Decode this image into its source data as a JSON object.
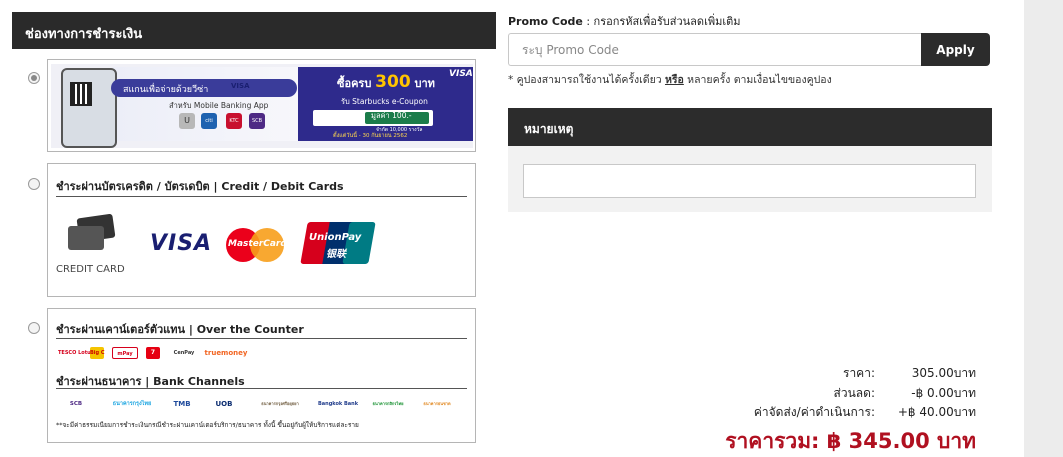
{
  "payment": {
    "header": "ช่องทางการชำระเงิน",
    "qr_banner": {
      "scan_text": "สแกนเพื่อจ่ายด้วยวีซ่า",
      "for_app": "สำหรับ Mobile Banking App",
      "brand": "VISA",
      "promo_head": "ซื้อครบ",
      "promo_amount": "300",
      "promo_unit": "บาท",
      "promo_sub": "รับ Starbucks e-Coupon",
      "coupon_value": "มูลค่า 100.-",
      "coupon_limit": "จำกัด 10,000 รางวัล",
      "period": "ตั้งแต่วันนี้ - 30 กันยายน 2562",
      "bank_logos": [
        "U",
        "citi",
        "KTC",
        "SCB"
      ]
    },
    "card_option": {
      "title": "ชำระผ่านบัตรเครดิต / บัตรเดบิต  |  Credit / Debit Cards",
      "credit_card_label": "CREDIT CARD",
      "visa_label": "VISA",
      "mastercard_label": "MasterCard",
      "unionpay_label": "UnionPay",
      "unionpay_cn": "银联"
    },
    "counter_option": {
      "title": "ชำระผ่านเคาน์เตอร์ตัวแทน  |  Over the Counter",
      "counter_logos": [
        "TESCO Lotus",
        "Big C",
        "mPay",
        "7",
        "CenPay",
        "truemoney"
      ],
      "bank_title": "ชำระผ่านธนาคาร  |  Bank Channels",
      "bank_logos": [
        "SCB",
        "ธนาคารกรุงไทย",
        "TMB",
        "UOB",
        "ธนาคารกรุงศรีอยุธยา",
        "Bangkok Bank",
        "ธนาคารกสิกรไทย",
        "ธนาคารธนชาต"
      ],
      "fee_note": "**จะมีค่าธรรมเนียมการชำระเงินกรณีชำระผ่านเคาน์เตอร์บริการ/ธนาคาร ทั้งนี้ ขึ้นอยู่กับผู้ให้บริการแต่ละราย"
    }
  },
  "promo": {
    "label": "Promo Code",
    "label_hint": " : กรอกรหัสเพื่อรับส่วนลดเพิ่มเติม",
    "placeholder": "ระบุ Promo Code",
    "apply": "Apply",
    "note_prefix": "* คูปองสามารถใช้งานได้ครั้งเดียว ",
    "note_or": "หรือ",
    "note_suffix": " หลายครั้ง ตามเงื่อนไขของคูปอง"
  },
  "remark": {
    "header": "หมายเหตุ",
    "value": ""
  },
  "summary": {
    "price_label": "ราคา:",
    "price_value": "305.00บาท",
    "discount_label": "ส่วนลด:",
    "discount_value": "-฿ 0.00บาท",
    "shipping_label": "ค่าจัดส่ง/ค่าดำเนินการ:",
    "shipping_value": "+฿ 40.00บาท",
    "total": "ราคารวม: ฿ 345.00 บาท"
  },
  "colors": {
    "header_bg": "#2c2c2c",
    "total_red": "#b01020",
    "banner_blue": "#2e2a8c"
  }
}
